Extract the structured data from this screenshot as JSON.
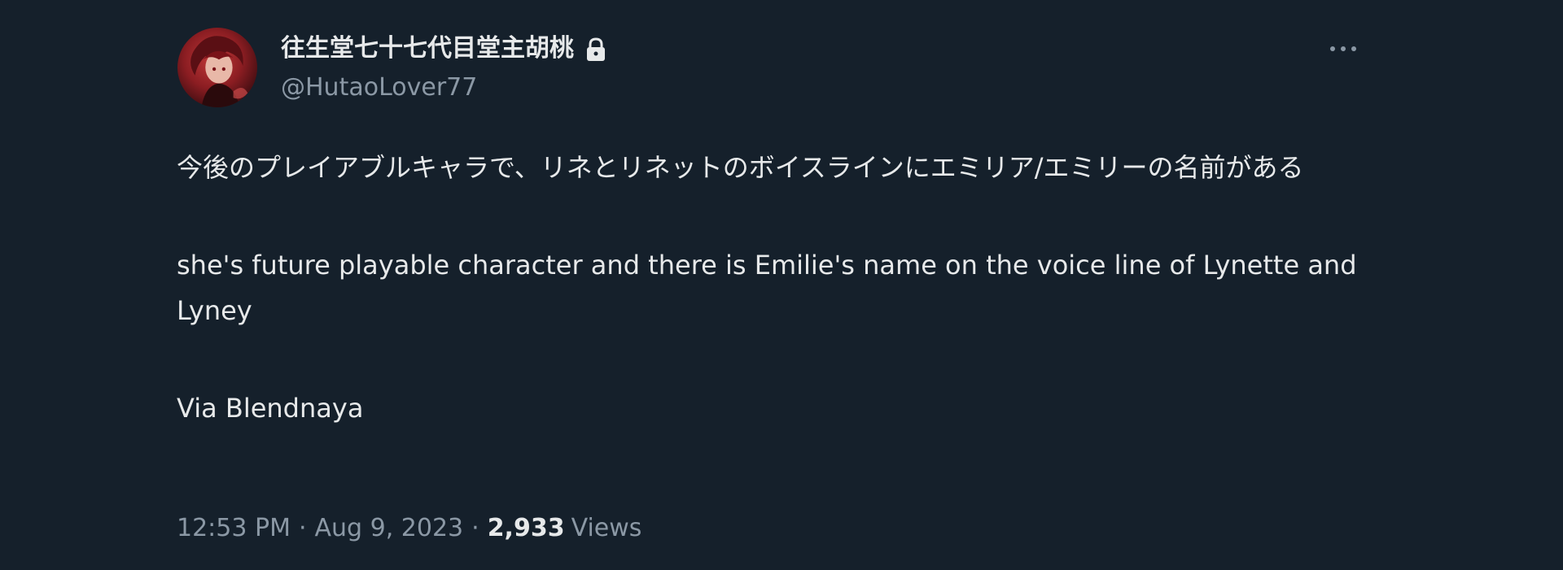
{
  "user": {
    "display_name": "往生堂七十七代目堂主胡桃",
    "handle": "@HutaoLover77",
    "protected_icon": "lock-icon",
    "avatar_icon": "avatar"
  },
  "menu": {
    "more_icon": "more-horizontal-icon"
  },
  "tweet": {
    "paragraph_jp": "今後のプレイアブルキャラで、リネとリネットのボイスラインにエミリア/エミリーの名前がある",
    "paragraph_en": "she's future playable character and there is Emilie's name on the voice line of Lynette and Lyney",
    "paragraph_via": "Via Blendnaya"
  },
  "meta": {
    "time": "12:53 PM",
    "separator": "·",
    "date": "Aug 9, 2023",
    "views_count": "2,933",
    "views_label": "Views"
  },
  "colors": {
    "background": "#15202b",
    "text_primary": "#e7e9ea",
    "text_secondary": "#8b98a5"
  }
}
